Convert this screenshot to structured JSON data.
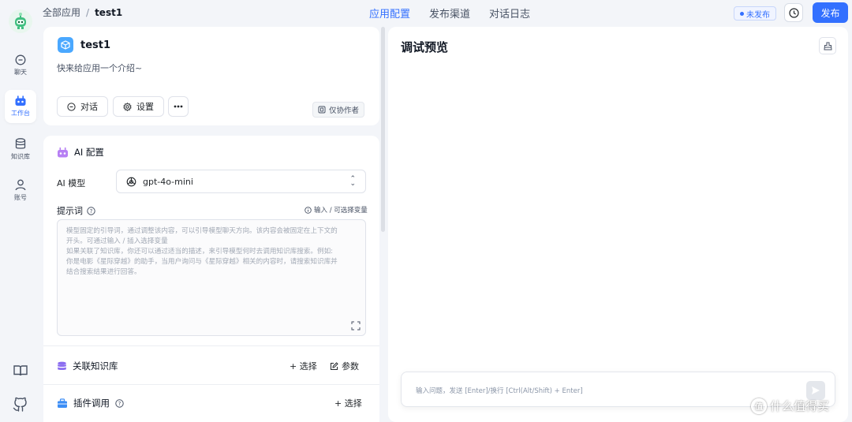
{
  "colors": {
    "accent": "#3370ff",
    "background": "#f3f5f9",
    "card": "#ffffff"
  },
  "sidebar": {
    "logo_icon": "robot-mascot-icon",
    "items": [
      {
        "label": "聊天",
        "icon": "chat-bubble-icon",
        "active": false
      },
      {
        "label": "工作台",
        "icon": "robot-icon",
        "active": true
      },
      {
        "label": "知识库",
        "icon": "database-icon",
        "active": false
      },
      {
        "label": "账号",
        "icon": "user-icon",
        "active": false
      }
    ],
    "bottom_icons": [
      "book-icon",
      "github-icon"
    ]
  },
  "header": {
    "breadcrumb": {
      "root": "全部应用",
      "separator": "/",
      "current": "test1"
    },
    "tabs": [
      {
        "label": "应用配置",
        "active": true
      },
      {
        "label": "发布渠道",
        "active": false
      },
      {
        "label": "对话日志",
        "active": false
      }
    ],
    "status_badge": "未发布",
    "history_icon": "clock-icon",
    "publish_label": "发布"
  },
  "app_card": {
    "name": "test1",
    "intro": "快来给应用一个介绍~",
    "chat_button": "对话",
    "settings_button": "设置",
    "more_icon": "ellipsis-icon",
    "collab_badge": "仅协作者"
  },
  "ai_config": {
    "title": "AI 配置",
    "model_label": "AI 模型",
    "model_value": "gpt-4o-mini",
    "prompt_label": "提示词",
    "prompt_hint": "输入 / 可选择变量",
    "prompt_placeholder_lines": [
      "模型固定的引导词，通过调整该内容，可以引导模型聊天方向。该内容会被固定在上下文的",
      "开头。可通过输入 / 插入选择变量",
      "如果关联了知识库，你还可以通过适当的描述，来引导模型何时去调用知识库搜索。例如:",
      "你是电影《星际穿越》的助手，当用户询问与《星际穿越》相关的内容时，请搜索知识库并",
      "结合搜索结果进行回答。"
    ]
  },
  "knowledge": {
    "title": "关联知识库",
    "select_label": "+ 选择",
    "params_label": "参数"
  },
  "plugins": {
    "title": "插件调用",
    "select_label": "+ 选择"
  },
  "preview": {
    "title": "调试预览",
    "input_placeholder": "输入问题，发送 [Enter]/换行 [Ctrl(Alt/Shift) + Enter]"
  },
  "watermark": {
    "badge": "值",
    "text": "什么值得买"
  }
}
